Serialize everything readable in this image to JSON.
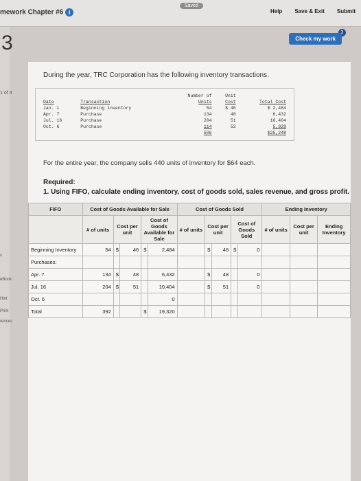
{
  "header": {
    "title": "mework Chapter #6",
    "saved_label": "Saved",
    "help_label": "Help",
    "save_exit_label": "Save & Exit",
    "submit_label": "Submit"
  },
  "question": {
    "number": "3",
    "counter": "1 of 4",
    "check_work_label": "Check my work",
    "check_badge": "3"
  },
  "side": {
    "references": "rences",
    "ebook": "eBook",
    "hint": "Hint",
    "print": "Print",
    "s": "s"
  },
  "intro": "During the year, TRC Corporation has the following inventory transactions.",
  "inventory": {
    "headers": {
      "date": "Date",
      "transaction": "Transaction",
      "number": "Number of",
      "units": "Units",
      "unit": "Unit",
      "cost": "Cost",
      "total_cost": "Total Cost"
    },
    "rows": [
      {
        "date": "Jan. 1",
        "transaction": "Beginning inventory",
        "units": "54",
        "unit_cost": "$ 46",
        "total_cost": "$ 2,484"
      },
      {
        "date": "Apr. 7",
        "transaction": "Purchase",
        "units": "134",
        "unit_cost": "48",
        "total_cost": "6,432"
      },
      {
        "date": "Jul. 16",
        "transaction": "Purchase",
        "units": "204",
        "unit_cost": "51",
        "total_cost": "10,404"
      },
      {
        "date": "Oct. 6",
        "transaction": "Purchase",
        "units": "114",
        "unit_cost": "52",
        "total_cost": "5,928"
      }
    ],
    "total_units": "506",
    "total_cost": "$25,248"
  },
  "sells_text": "For the entire year, the company sells 440 units of inventory for $64 each.",
  "required_title": "Required:",
  "required_1": "1. Using FIFO, calculate ending inventory, cost of goods sold, sales revenue, and gross profit.",
  "fifo": {
    "corner": "FIFO",
    "group1": "Cost of Goods Available for Sale",
    "group2": "Cost of Goods Sold",
    "group3": "Ending Inventory",
    "col_units": "# of units",
    "col_cost_per": "Cost per unit",
    "col_cost_goods_avail": "Cost of Goods Available for Sale",
    "col_cost_goods_sold": "Cost of Goods Sold",
    "col_ending_cost": "Cost per unit",
    "col_ending_inv": "Ending Inventory",
    "rows": [
      {
        "label": "Beginning Inventory",
        "u": "54",
        "cs": "$",
        "c": "46",
        "ts": "$",
        "t": "2,484",
        "su": "",
        "ss": "$",
        "sc": "46",
        "st": "$",
        "sv": "0",
        "eu": "",
        "ec": "",
        "ev": ""
      },
      {
        "label": "Purchases:",
        "u": "",
        "cs": "",
        "c": "",
        "ts": "",
        "t": "",
        "su": "",
        "ss": "",
        "sc": "",
        "st": "",
        "sv": "",
        "eu": "",
        "ec": "",
        "ev": ""
      },
      {
        "label": "Apr. 7",
        "u": "134",
        "cs": "$",
        "c": "48",
        "ts": "",
        "t": "6,432",
        "su": "",
        "ss": "$",
        "sc": "48",
        "st": "",
        "sv": "0",
        "eu": "",
        "ec": "",
        "ev": ""
      },
      {
        "label": "Jul. 16",
        "u": "204",
        "cs": "$",
        "c": "51",
        "ts": "",
        "t": "10,404",
        "su": "",
        "ss": "$",
        "sc": "51",
        "st": "",
        "sv": "0",
        "eu": "",
        "ec": "",
        "ev": ""
      },
      {
        "label": "Oct. 6",
        "u": "",
        "cs": "",
        "c": "",
        "ts": "",
        "t": "0",
        "su": "",
        "ss": "",
        "sc": "",
        "st": "",
        "sv": "",
        "eu": "",
        "ec": "",
        "ev": ""
      },
      {
        "label": "Total",
        "u": "392",
        "cs": "",
        "c": "",
        "ts": "$",
        "t": "19,320",
        "su": "",
        "ss": "",
        "sc": "",
        "st": "",
        "sv": "",
        "eu": "",
        "ec": "",
        "ev": ""
      }
    ]
  }
}
